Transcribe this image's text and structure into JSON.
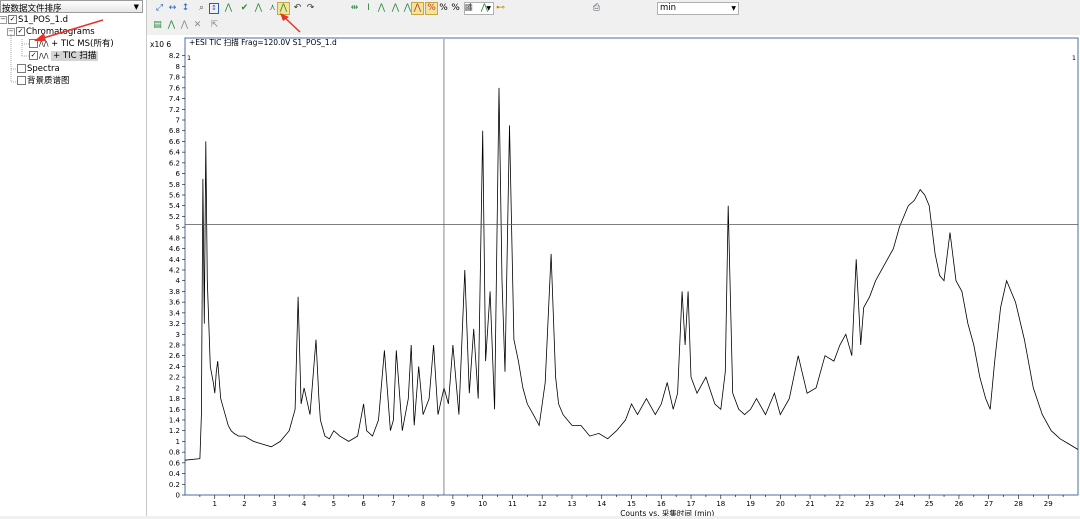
{
  "sidebar": {
    "sort_label": "按数据文件排序",
    "file": "S1_POS_1.d",
    "chromatograms": "Chromatograms",
    "tic_ms_all": "+ TIC MS(所有)",
    "tic_scan": "+ TIC 扫描",
    "spectra": "Spectra",
    "background": "背景质谱图",
    "trace_glyph": "/\\/\\"
  },
  "toolbar": {
    "zoom_value": "4",
    "time_unit": "min",
    "percent1": "%",
    "percent2": "%"
  },
  "annotation": {
    "arrow_color": "#e8312a"
  },
  "chart_data": {
    "type": "line",
    "title": "+ESI TIC 扫描 Frag=120.0V S1_POS_1.d",
    "ylabel_multiplier": "x10 6",
    "xlabel": "Counts vs. 采集时间 (min)",
    "corner_left": "1",
    "corner_right": "1",
    "xlim": [
      0,
      30
    ],
    "ylim": [
      0,
      8.4
    ],
    "cursor": {
      "x": 8.7,
      "y": 5.05
    },
    "x": [
      0,
      0.5,
      0.55,
      0.6,
      0.65,
      0.7,
      0.75,
      0.85,
      0.95,
      1.0,
      1.05,
      1.1,
      1.2,
      1.3,
      1.45,
      1.55,
      1.65,
      1.8,
      2.0,
      2.3,
      2.6,
      2.9,
      3.2,
      3.5,
      3.7,
      3.8,
      3.9,
      4.0,
      4.2,
      4.4,
      4.5,
      4.55,
      4.6,
      4.7,
      4.85,
      5.0,
      5.2,
      5.5,
      5.8,
      6.0,
      6.1,
      6.3,
      6.5,
      6.7,
      6.9,
      7.0,
      7.1,
      7.3,
      7.5,
      7.6,
      7.7,
      7.85,
      8.0,
      8.2,
      8.35,
      8.5,
      8.7,
      8.85,
      9.0,
      9.2,
      9.4,
      9.55,
      9.7,
      9.85,
      10.0,
      10.1,
      10.25,
      10.4,
      10.55,
      10.65,
      10.75,
      10.9,
      11.05,
      11.2,
      11.35,
      11.5,
      11.7,
      11.9,
      12.1,
      12.3,
      12.45,
      12.55,
      12.7,
      12.85,
      13.0,
      13.3,
      13.6,
      13.9,
      14.2,
      14.5,
      14.8,
      15.0,
      15.2,
      15.5,
      15.8,
      16.0,
      16.2,
      16.4,
      16.55,
      16.7,
      16.8,
      16.9,
      17.0,
      17.2,
      17.5,
      17.8,
      18.0,
      18.15,
      18.25,
      18.4,
      18.6,
      18.8,
      19.0,
      19.2,
      19.5,
      19.8,
      20.0,
      20.3,
      20.6,
      20.9,
      21.2,
      21.5,
      21.8,
      22.0,
      22.2,
      22.4,
      22.55,
      22.7,
      22.8,
      23.0,
      23.2,
      23.5,
      23.8,
      24.0,
      24.3,
      24.5,
      24.7,
      24.85,
      25.0,
      25.2,
      25.35,
      25.5,
      25.7,
      25.9,
      26.1,
      26.3,
      26.5,
      26.7,
      26.9,
      27.05,
      27.2,
      27.4,
      27.6,
      27.9,
      28.2,
      28.5,
      28.8,
      29.1,
      29.4,
      29.7,
      30.0
    ],
    "values": [
      0.65,
      0.68,
      1.5,
      5.9,
      3.2,
      6.6,
      4.0,
      2.4,
      2.1,
      1.9,
      2.3,
      2.5,
      1.8,
      1.6,
      1.3,
      1.2,
      1.15,
      1.1,
      1.1,
      1.0,
      0.95,
      0.9,
      1.0,
      1.2,
      1.6,
      3.7,
      1.7,
      2.0,
      1.5,
      2.9,
      1.8,
      1.4,
      1.3,
      1.1,
      1.05,
      1.2,
      1.1,
      1.0,
      1.1,
      1.7,
      1.2,
      1.1,
      1.4,
      2.7,
      1.2,
      1.4,
      2.7,
      1.2,
      1.8,
      2.8,
      1.3,
      2.4,
      1.5,
      1.8,
      2.8,
      1.5,
      2.0,
      1.7,
      2.8,
      1.5,
      4.2,
      1.9,
      3.1,
      1.8,
      6.8,
      2.5,
      3.8,
      1.6,
      7.6,
      4.0,
      2.3,
      6.9,
      2.9,
      2.5,
      2.0,
      1.7,
      1.5,
      1.3,
      2.1,
      4.5,
      2.2,
      1.7,
      1.5,
      1.4,
      1.3,
      1.3,
      1.1,
      1.15,
      1.05,
      1.2,
      1.4,
      1.7,
      1.5,
      1.8,
      1.5,
      1.7,
      2.1,
      1.6,
      1.9,
      3.8,
      2.8,
      3.8,
      2.2,
      1.9,
      2.2,
      1.7,
      1.6,
      2.3,
      5.4,
      1.9,
      1.6,
      1.5,
      1.6,
      1.8,
      1.5,
      1.9,
      1.5,
      1.8,
      2.6,
      1.9,
      2.0,
      2.6,
      2.5,
      2.8,
      3.0,
      2.6,
      4.4,
      2.8,
      3.5,
      3.7,
      4.0,
      4.3,
      4.6,
      5.0,
      5.4,
      5.5,
      5.7,
      5.6,
      5.4,
      4.5,
      4.1,
      4.0,
      4.9,
      4.0,
      3.8,
      3.2,
      2.8,
      2.2,
      1.8,
      1.6,
      2.5,
      3.5,
      4.0,
      3.6,
      2.9,
      2.0,
      1.5,
      1.2,
      1.05,
      0.95,
      0.85,
      0.8
    ]
  }
}
